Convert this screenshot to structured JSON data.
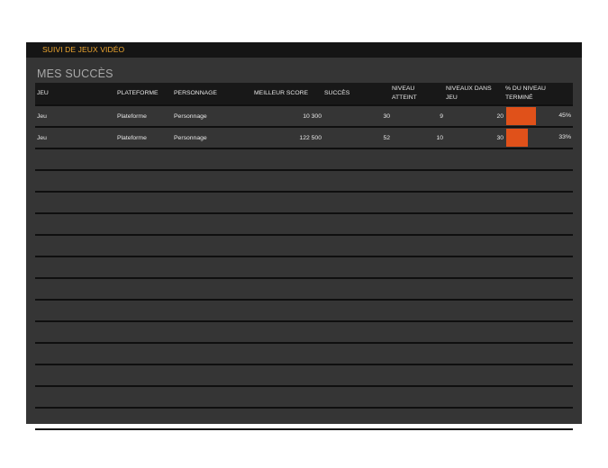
{
  "header": {
    "title": "SUIVI DE JEUX VIDÉO"
  },
  "section": {
    "title": "MES SUCCÈS"
  },
  "columns": {
    "game": "JEU",
    "platform": "PLATEFORME",
    "character": "PERSONNAGE",
    "best_score": "MEILLEUR SCORE",
    "success": "SUCCÈS",
    "level_reached_1": "NIVEAU",
    "level_reached_2": "ATTEINT",
    "levels_in_game_1": "NIVEAUX DANS",
    "levels_in_game_2": "JEU",
    "pct_done_1": "% DU NIVEAU",
    "pct_done_2": "TERMINÉ"
  },
  "rows": [
    {
      "game": "Jeu",
      "platform": "Plateforme",
      "character": "Personnage",
      "best_score": "10 300",
      "success": "30",
      "level_reached": "9",
      "levels_in_game": "20",
      "pct_label": "45%",
      "pct_value": 0.45
    },
    {
      "game": "Jeu",
      "platform": "Plateforme",
      "character": "Personnage",
      "best_score": "122 500",
      "success": "52",
      "level_reached": "10",
      "levels_in_game": "30",
      "pct_label": "33%",
      "pct_value": 0.33
    }
  ],
  "colors": {
    "bar": "#e0511a",
    "title": "#f0a830"
  }
}
